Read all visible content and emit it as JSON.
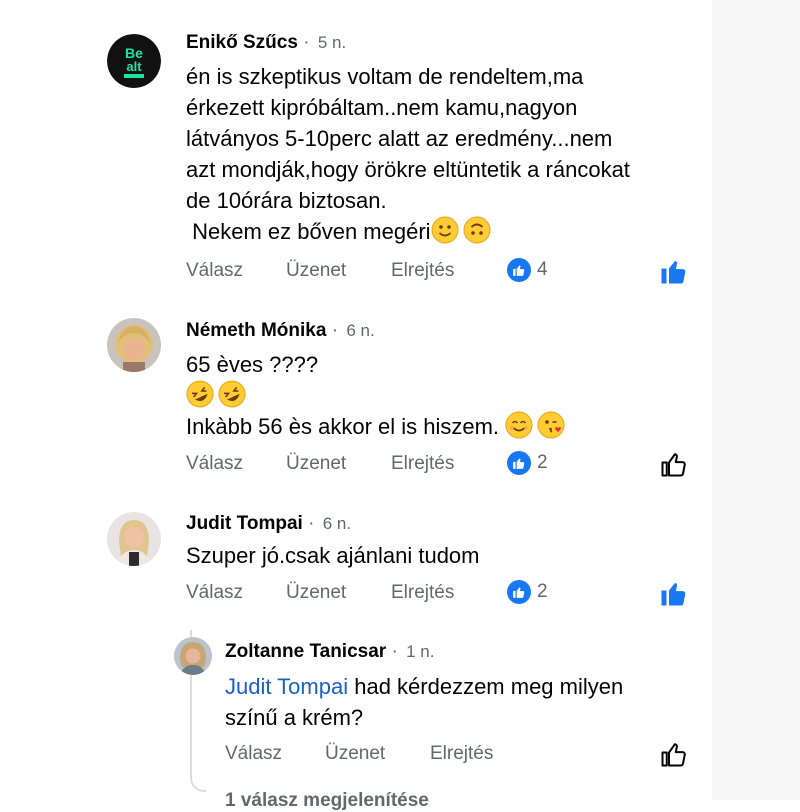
{
  "actions": {
    "reply": "Válasz",
    "message": "Üzenet",
    "hide": "Elrejtés"
  },
  "separator": "·",
  "comments": [
    {
      "author": "Enikő Szűcs",
      "time": "5 n.",
      "avatar": "Be alt festival logo",
      "lines": [
        "én is szkeptikus voltam de rendeltem,ma",
        "érkezett kipróbáltam..nem kamu,nagyon",
        "látványos 5-10perc alatt az eredmény...nem",
        "azt mondják,hogy örökre eltüntetik a ráncokat",
        "de 10órára biztosan.",
        " Nekem ez bőven megéri"
      ],
      "reaction_count": "4",
      "liked": true
    },
    {
      "author": "Németh Mónika",
      "time": "6 n.",
      "lines": [
        "65 èves ????",
        "",
        "Inkàbb 56 ès akkor el is hiszem. "
      ],
      "reaction_count": "2",
      "liked": false
    },
    {
      "author": "Judit Tompai",
      "time": "6 n.",
      "lines": [
        "Szuper jó.csak ajánlani tudom"
      ],
      "reaction_count": "2",
      "liked": true
    },
    {
      "author": "Zoltanne Tanicsar",
      "time": "1 n.",
      "mention": "Judit Tompai",
      "lines": [
        " had kérdezzem meg milyen",
        "színű a krém?"
      ],
      "liked": false
    }
  ],
  "footer": {
    "more_replies": "1 válasz megjelenítése"
  },
  "colors": {
    "accent": "#1877f2",
    "mention": "#1a60c8",
    "meta": "#65676b"
  }
}
